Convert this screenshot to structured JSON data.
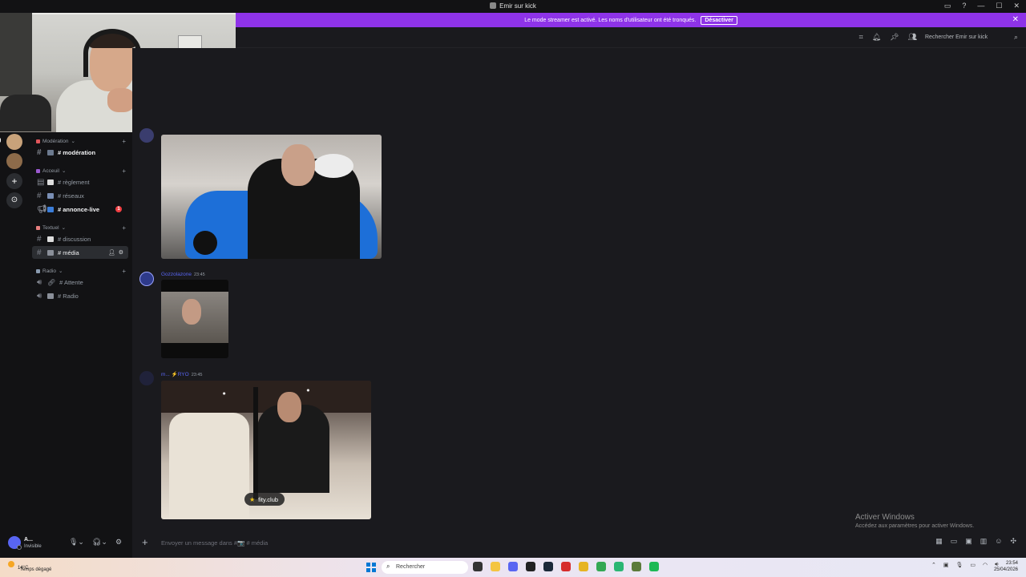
{
  "window": {
    "title": "Emir sur kick",
    "controls": [
      "▭",
      "?",
      "—",
      "☐",
      "✕"
    ]
  },
  "banner": {
    "message": "Le mode streamer est activé. Les noms d'utilisateur ont été tronqués.",
    "button": "Désactiver",
    "close": "✕"
  },
  "header": {
    "search_placeholder": "Rechercher Emir sur kick"
  },
  "sidebar": {
    "categories": [
      {
        "label": "Modération",
        "color": "#e0565b"
      },
      {
        "label": "Acceuil",
        "color": "#9b59d0"
      },
      {
        "label": "Textuel",
        "color": "#e77f7f"
      },
      {
        "label": "Radio",
        "color": "#8a9bb0"
      }
    ],
    "channels": [
      {
        "label": "# modération"
      },
      {
        "label": "# règlement"
      },
      {
        "label": "# réseaux"
      },
      {
        "label": "# annonce-live",
        "badge": "1"
      },
      {
        "label": "# discussion"
      },
      {
        "label": "# média"
      },
      {
        "label": "# Attente"
      },
      {
        "label": "# Radio"
      }
    ]
  },
  "user": {
    "name": "A...",
    "status": "Invisible"
  },
  "messages": [
    {
      "author": "Gozzolazone",
      "time": "23:45",
      "author_color": "#5865f2"
    },
    {
      "author": "m... ⚡RYO",
      "time": "23:45",
      "author_color": "#5865f2"
    }
  ],
  "media_tag": "fity.club",
  "composer": {
    "placeholder": "Envoyer un message dans #📷 # média"
  },
  "activate": {
    "title": "Activer Windows",
    "subtitle": "Accédez aux paramètres pour activer Windows."
  },
  "taskbar": {
    "temp": "14°C",
    "weather": "Temps dégagé",
    "search": "Rechercher",
    "time": "23:54",
    "date": "25/04/2026"
  }
}
